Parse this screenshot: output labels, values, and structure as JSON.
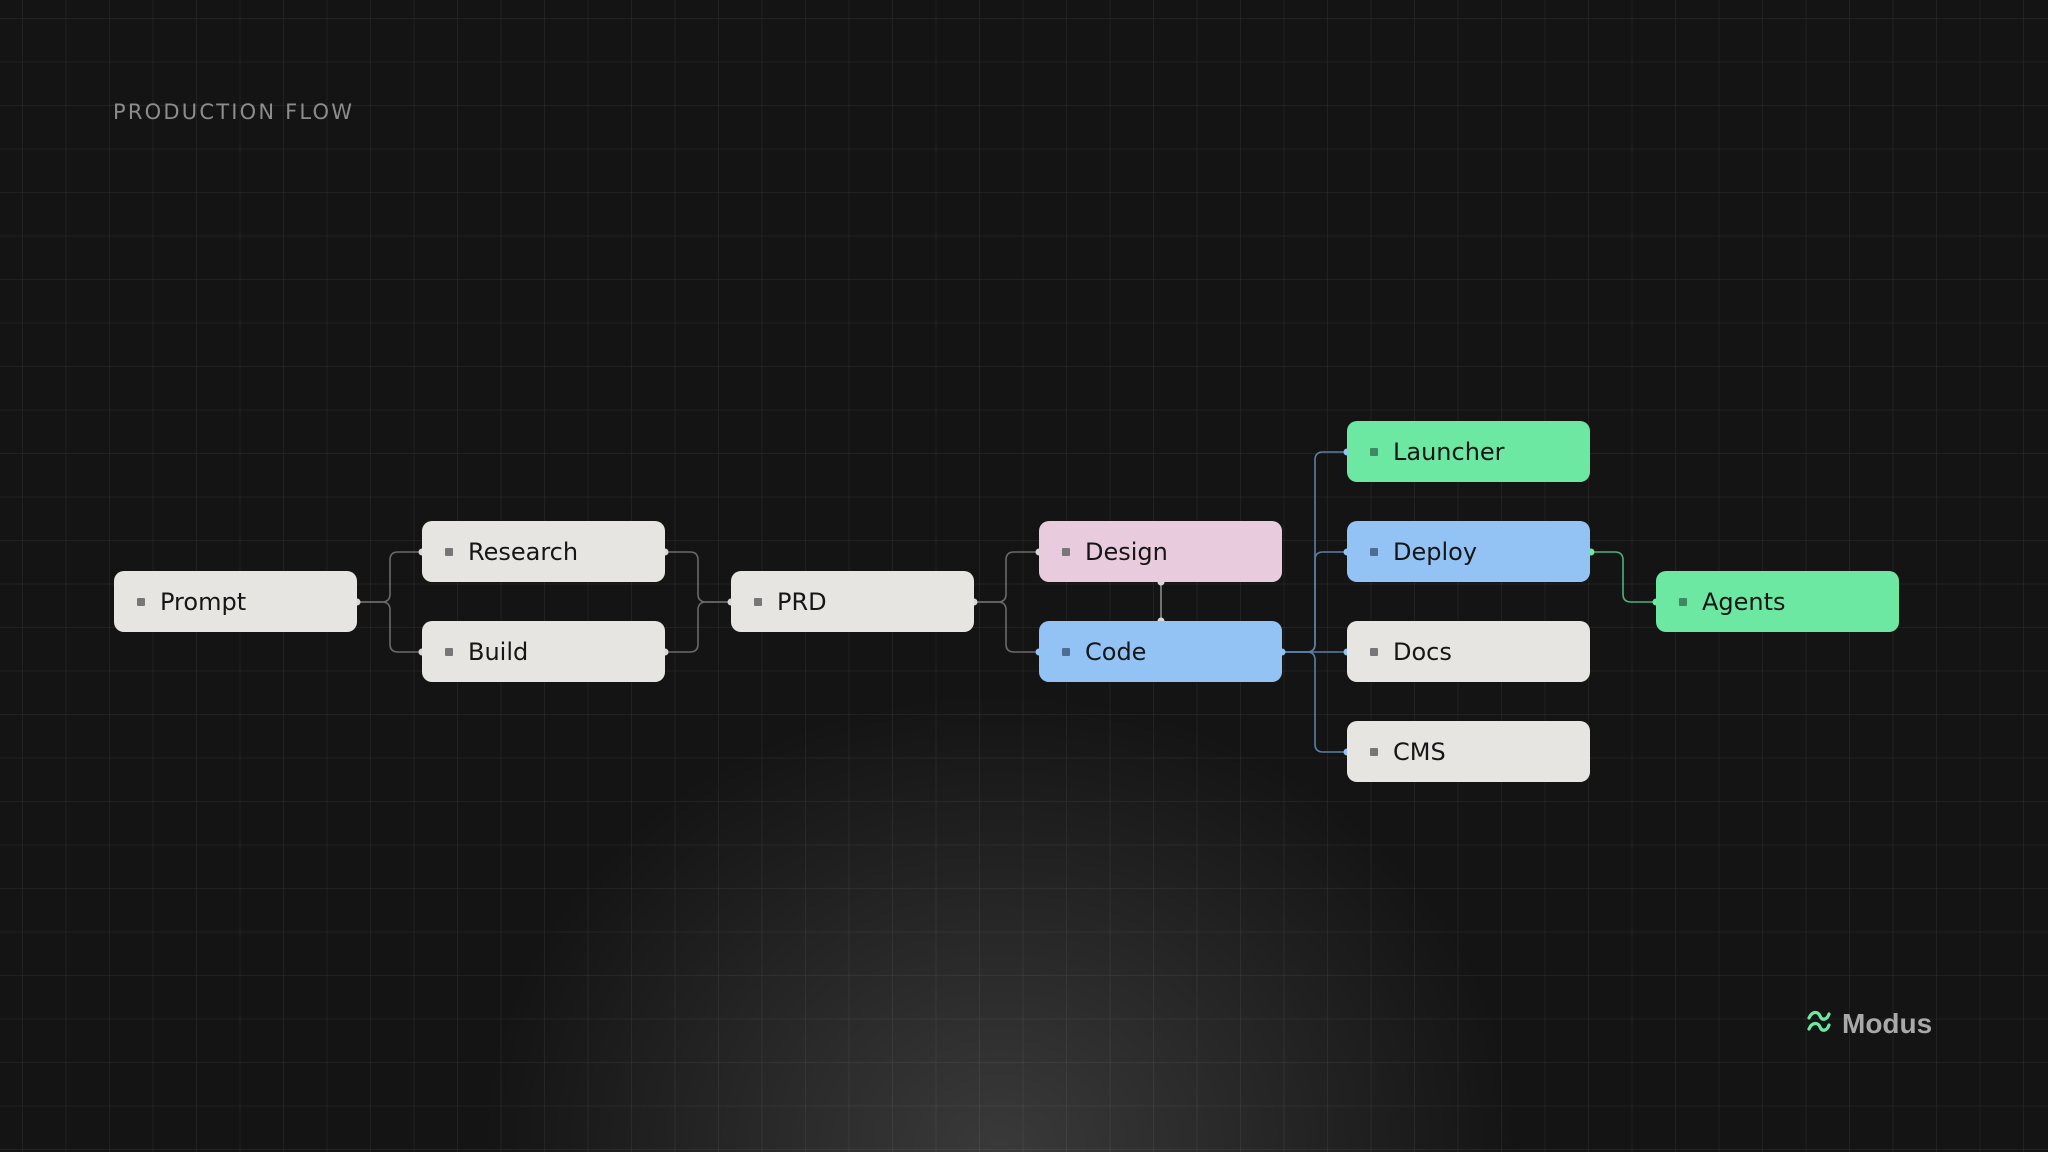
{
  "title": "PRODUCTION FLOW",
  "brand": {
    "name": "Modus",
    "icon": "modus-logo-icon",
    "icon_color": "#6de8a3"
  },
  "colors": {
    "gray": "#e6e5e1",
    "pink": "#e8cbdc",
    "blue": "#93c3f4",
    "green": "#6de8a3",
    "edge_gray": "#6a6a6a",
    "edge_blue": "#5c7fa6",
    "edge_green": "#4fb07d"
  },
  "nodes": {
    "prompt": {
      "label": "Prompt"
    },
    "research": {
      "label": "Research"
    },
    "build": {
      "label": "Build"
    },
    "prd": {
      "label": "PRD"
    },
    "design": {
      "label": "Design"
    },
    "code": {
      "label": "Code"
    },
    "launcher": {
      "label": "Launcher"
    },
    "deploy": {
      "label": "Deploy"
    },
    "docs": {
      "label": "Docs"
    },
    "cms": {
      "label": "CMS"
    },
    "agents": {
      "label": "Agents"
    }
  }
}
